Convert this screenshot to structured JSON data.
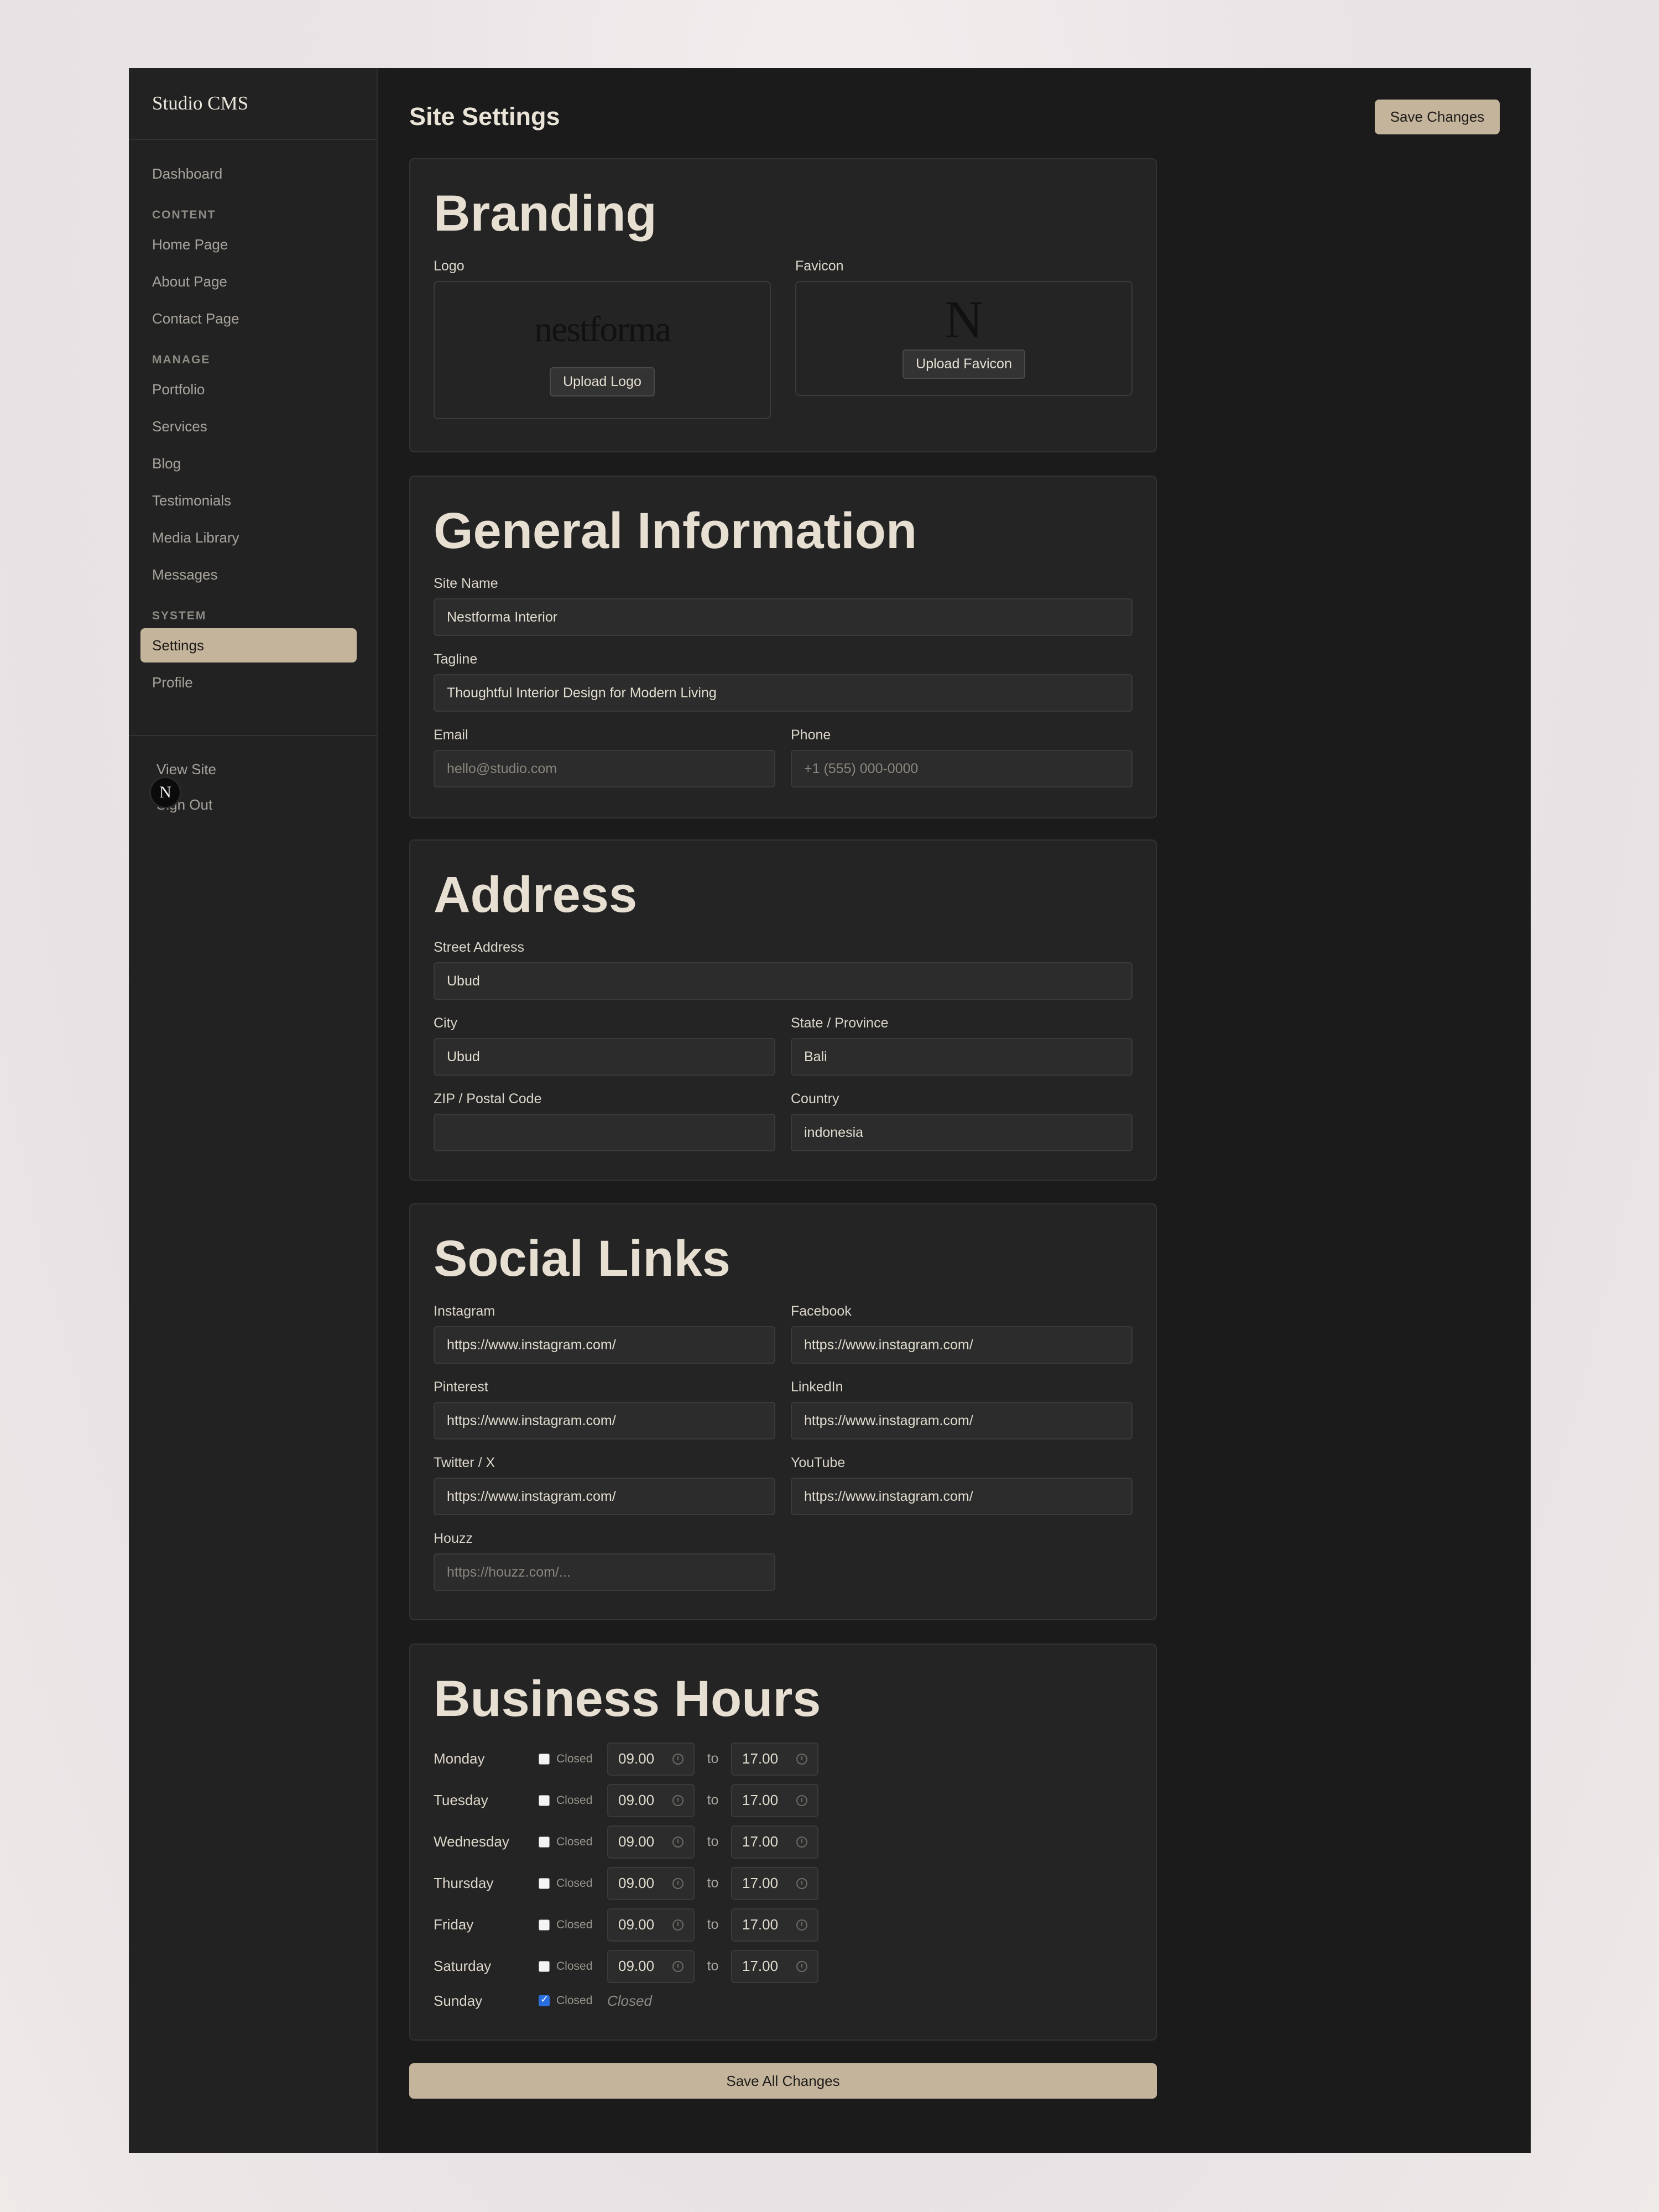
{
  "sidebar": {
    "brand": "Studio CMS",
    "dashboard": "Dashboard",
    "sections": [
      {
        "title": "CONTENT",
        "items": [
          "Home Page",
          "About Page",
          "Contact Page"
        ]
      },
      {
        "title": "MANAGE",
        "items": [
          "Portfolio",
          "Services",
          "Blog",
          "Testimonials",
          "Media Library",
          "Messages"
        ]
      },
      {
        "title": "SYSTEM",
        "items": [
          "Settings",
          "Profile"
        ]
      }
    ],
    "active_item": "Settings",
    "footer": {
      "view_site": "View Site",
      "sign_out": "Sign Out",
      "avatar_letter": "N"
    }
  },
  "header": {
    "title": "Site Settings",
    "save_label": "Save Changes"
  },
  "branding": {
    "title": "Branding",
    "logo_label": "Logo",
    "logo_text": "nestforma",
    "upload_logo": "Upload Logo",
    "favicon_label": "Favicon",
    "favicon_text": "N",
    "upload_favicon": "Upload Favicon"
  },
  "general": {
    "title": "General Information",
    "site_name_label": "Site Name",
    "site_name": "Nestforma Interior",
    "tagline_label": "Tagline",
    "tagline": "Thoughtful Interior Design for Modern Living",
    "email_label": "Email",
    "email_placeholder": "hello@studio.com",
    "phone_label": "Phone",
    "phone_placeholder": "+1 (555) 000-0000"
  },
  "address": {
    "title": "Address",
    "street_label": "Street Address",
    "street": "Ubud",
    "city_label": "City",
    "city": "Ubud",
    "state_label": "State / Province",
    "state": "Bali",
    "zip_label": "ZIP / Postal Code",
    "zip": "",
    "country_label": "Country",
    "country": "indonesia"
  },
  "social": {
    "title": "Social Links",
    "instagram_label": "Instagram",
    "instagram": "https://www.instagram.com/",
    "facebook_label": "Facebook",
    "facebook": "https://www.instagram.com/",
    "pinterest_label": "Pinterest",
    "pinterest": "https://www.instagram.com/",
    "linkedin_label": "LinkedIn",
    "linkedin": "https://www.instagram.com/",
    "twitter_label": "Twitter / X",
    "twitter": "https://www.instagram.com/",
    "youtube_label": "YouTube",
    "youtube": "https://www.instagram.com/",
    "houzz_label": "Houzz",
    "houzz_placeholder": "https://houzz.com/..."
  },
  "hours": {
    "title": "Business Hours",
    "closed_label": "Closed",
    "to_label": "to",
    "days": [
      {
        "day": "Monday",
        "closed": false,
        "open": "09.00",
        "close": "17.00"
      },
      {
        "day": "Tuesday",
        "closed": false,
        "open": "09.00",
        "close": "17.00"
      },
      {
        "day": "Wednesday",
        "closed": false,
        "open": "09.00",
        "close": "17.00"
      },
      {
        "day": "Thursday",
        "closed": false,
        "open": "09.00",
        "close": "17.00"
      },
      {
        "day": "Friday",
        "closed": false,
        "open": "09.00",
        "close": "17.00"
      },
      {
        "day": "Saturday",
        "closed": false,
        "open": "09.00",
        "close": "17.00"
      },
      {
        "day": "Sunday",
        "closed": true,
        "closed_text": "Closed"
      }
    ]
  },
  "footer_action": {
    "save_all": "Save All Changes"
  },
  "colors": {
    "accent": "#c5b49c",
    "panel": "#242424",
    "background": "#1b1b1b"
  }
}
